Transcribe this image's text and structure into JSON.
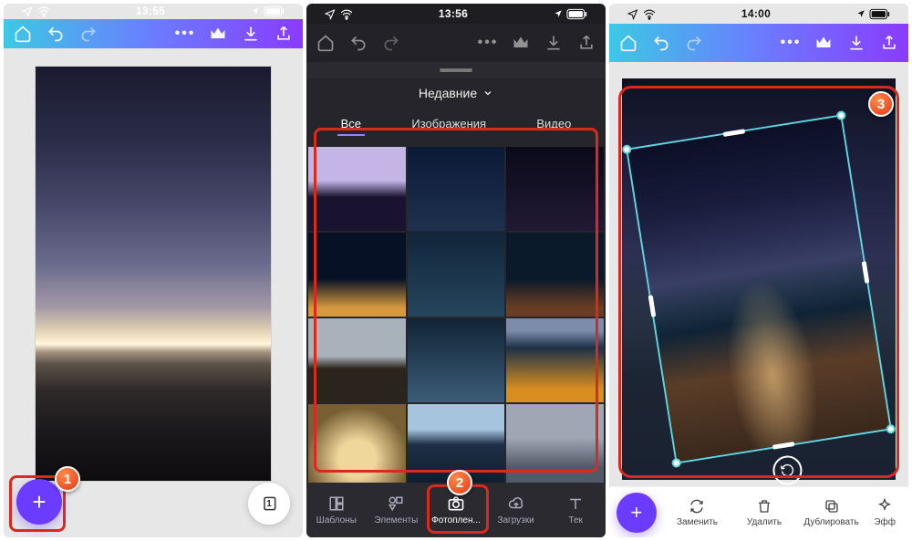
{
  "phones": [
    {
      "time": "13:55"
    },
    {
      "time": "13:56"
    },
    {
      "time": "14:00"
    }
  ],
  "drawer": {
    "recent": "Недавние",
    "tabs": {
      "all": "Все",
      "images": "Изображения",
      "video": "Видео"
    }
  },
  "bottom_tabs": {
    "templates": "Шаблоны",
    "elements": "Элементы",
    "camera_roll": "Фотоплен...",
    "uploads": "Загрузки",
    "text": "Тек"
  },
  "actions": {
    "replace": "Заменить",
    "delete": "Удалить",
    "duplicate": "Дублировать",
    "effects": "Эфф"
  },
  "badges": {
    "b1": "1",
    "b2": "2",
    "b3": "3"
  },
  "page_count": "1"
}
